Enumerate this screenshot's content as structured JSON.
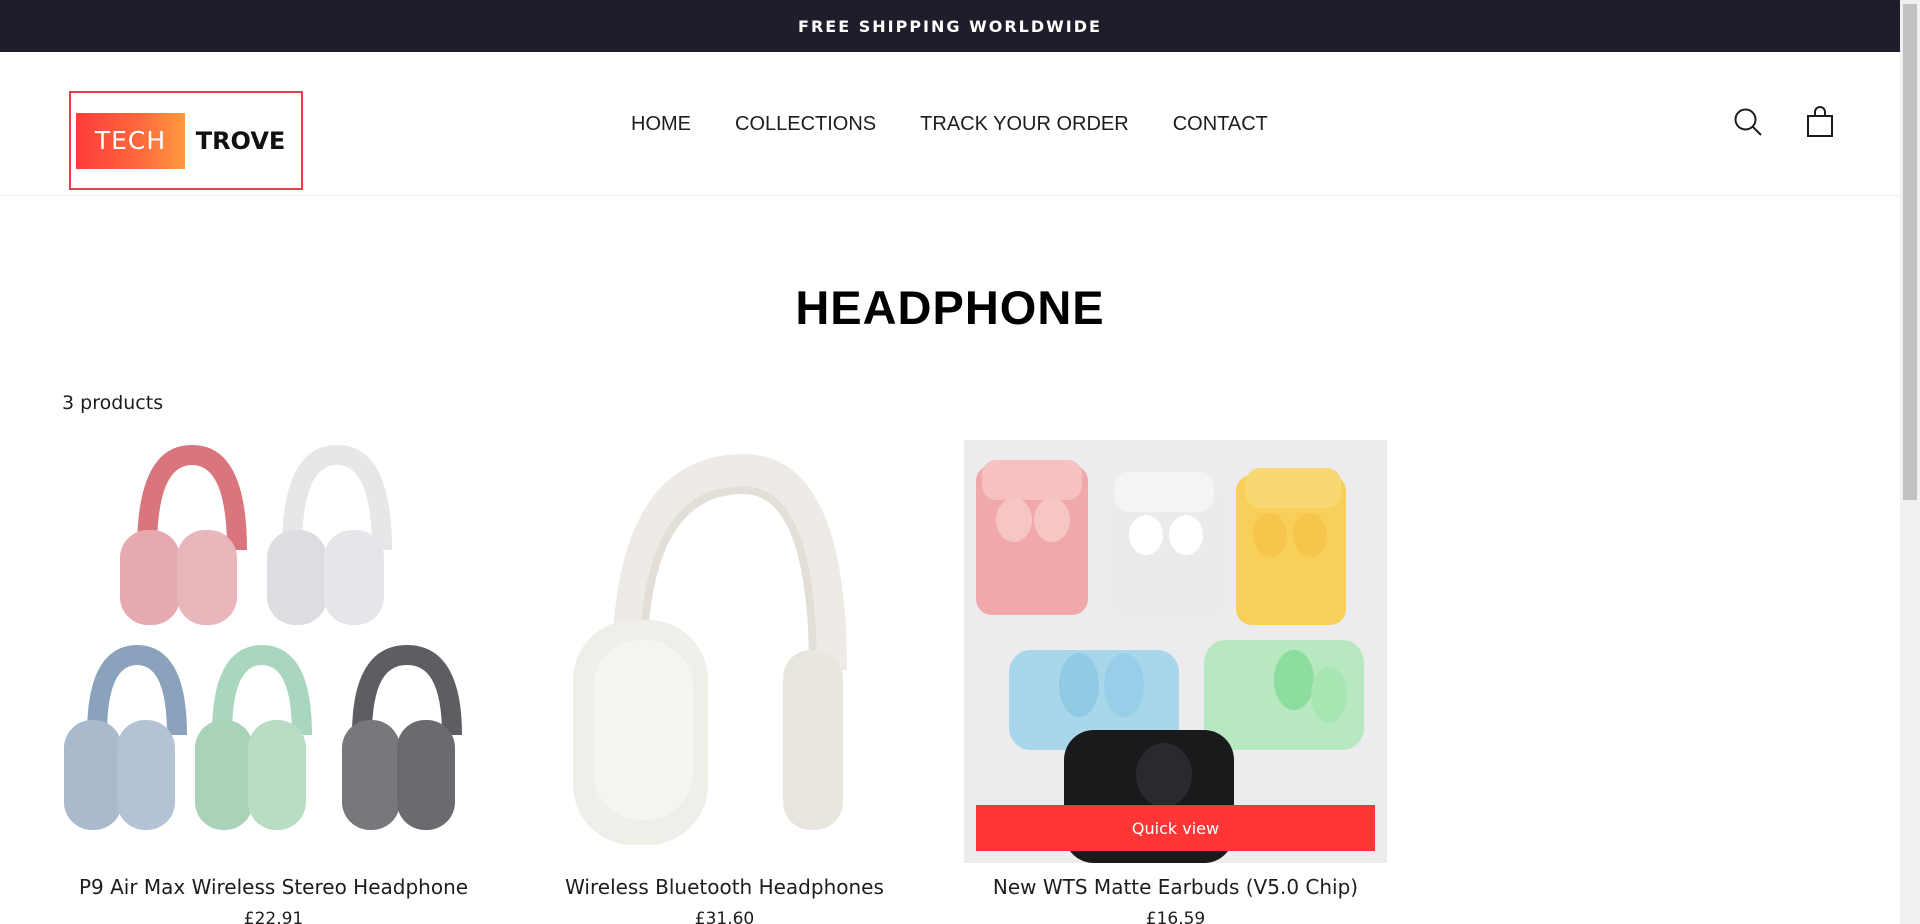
{
  "announcement": {
    "text": "FREE SHIPPING WORLDWIDE"
  },
  "header": {
    "logo": {
      "left": "TECH",
      "right": "TROVE"
    },
    "nav": [
      {
        "label": "HOME"
      },
      {
        "label": "COLLECTIONS"
      },
      {
        "label": "TRACK YOUR ORDER"
      },
      {
        "label": "CONTACT"
      }
    ],
    "icons": {
      "search": "search-icon",
      "cart": "cart-icon"
    }
  },
  "collection": {
    "title": "HEADPHONE",
    "count": "3 products",
    "products": [
      {
        "title": "P9 Air Max Wireless Stereo Headphone",
        "price": "£22.91"
      },
      {
        "title": "Wireless Bluetooth Headphones",
        "price": "£31.60"
      },
      {
        "title": "New WTS Matte Earbuds (V5.0 Chip)",
        "price": "£16.59",
        "quick_view": "Quick view"
      }
    ]
  },
  "colors": {
    "accent": "#ff3636",
    "announcement_bg": "#1e1e2a"
  }
}
